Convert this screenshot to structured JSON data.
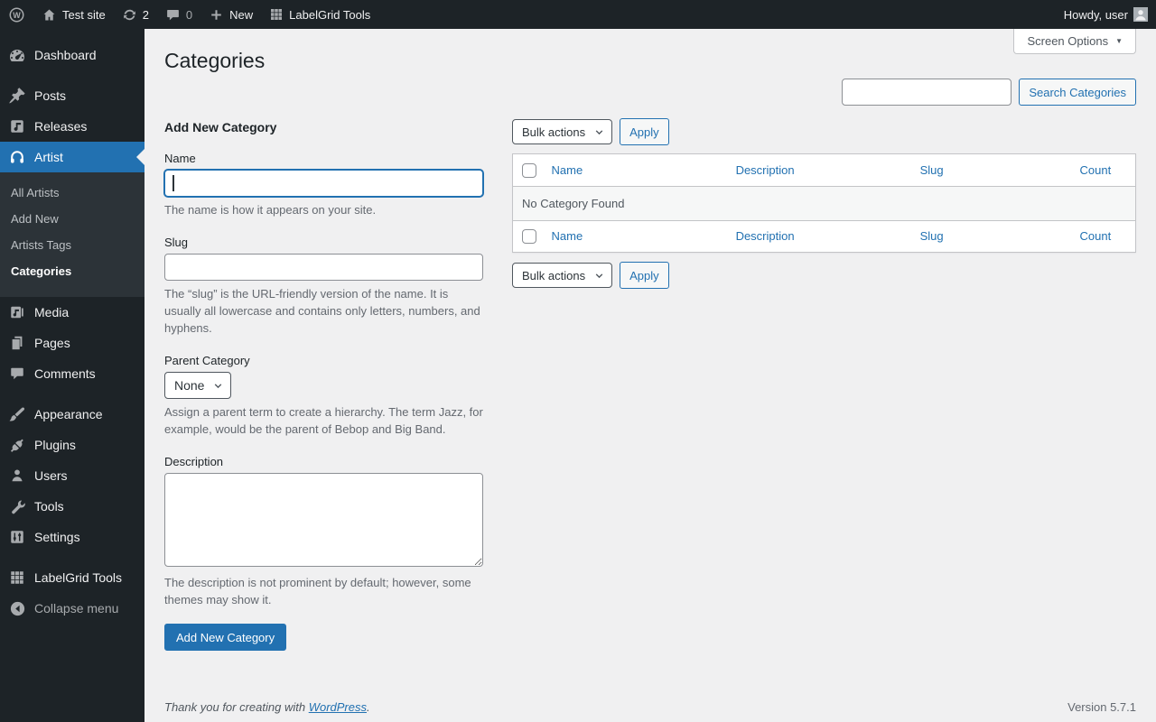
{
  "colors": {
    "accent": "#2271b1",
    "sidebar_bg": "#1d2327",
    "submenu_bg": "#2c3338",
    "content_bg": "#f0f0f1"
  },
  "admin_bar": {
    "site_name": "Test site",
    "update_count": "2",
    "comment_count": "0",
    "new_label": "New",
    "labelgrid_label": "LabelGrid Tools",
    "howdy": "Howdy, user"
  },
  "sidebar": {
    "items": [
      {
        "label": "Dashboard",
        "icon": "dashboard-icon"
      },
      {
        "label": "Posts",
        "icon": "pin-icon"
      },
      {
        "label": "Releases",
        "icon": "music-note-icon"
      },
      {
        "label": "Artist",
        "icon": "headphones-icon"
      },
      {
        "label": "Media",
        "icon": "media-icon"
      },
      {
        "label": "Pages",
        "icon": "pages-icon"
      },
      {
        "label": "Comments",
        "icon": "comment-icon"
      },
      {
        "label": "Appearance",
        "icon": "brush-icon"
      },
      {
        "label": "Plugins",
        "icon": "plug-icon"
      },
      {
        "label": "Users",
        "icon": "user-icon"
      },
      {
        "label": "Tools",
        "icon": "wrench-icon"
      },
      {
        "label": "Settings",
        "icon": "sliders-icon"
      },
      {
        "label": "LabelGrid Tools",
        "icon": "grid-icon"
      },
      {
        "label": "Collapse menu",
        "icon": "collapse-arrow-icon"
      }
    ],
    "artist_submenu": [
      "All Artists",
      "Add New",
      "Artists Tags",
      "Categories"
    ]
  },
  "page": {
    "title": "Categories",
    "screen_options": "Screen Options",
    "search_button": "Search Categories",
    "search_value": ""
  },
  "form": {
    "heading": "Add New Category",
    "name_label": "Name",
    "name_value": "",
    "name_help": "The name is how it appears on your site.",
    "slug_label": "Slug",
    "slug_value": "",
    "slug_help": "The “slug” is the URL-friendly version of the name. It is usually all lowercase and contains only letters, numbers, and hyphens.",
    "parent_label": "Parent Category",
    "parent_value": "None",
    "parent_help": "Assign a parent term to create a hierarchy. The term Jazz, for example, would be the parent of Bebop and Big Band.",
    "description_label": "Description",
    "description_value": "",
    "description_help": "The description is not prominent by default; however, some themes may show it.",
    "submit_label": "Add New Category"
  },
  "table": {
    "bulk_actions_label": "Bulk actions",
    "apply_label": "Apply",
    "columns": [
      "Name",
      "Description",
      "Slug",
      "Count"
    ],
    "empty_message": "No Category Found"
  },
  "footer": {
    "thanks_prefix": "Thank you for creating with ",
    "wordpress_link": "WordPress",
    "thanks_suffix": ".",
    "version": "Version 5.7.1"
  }
}
